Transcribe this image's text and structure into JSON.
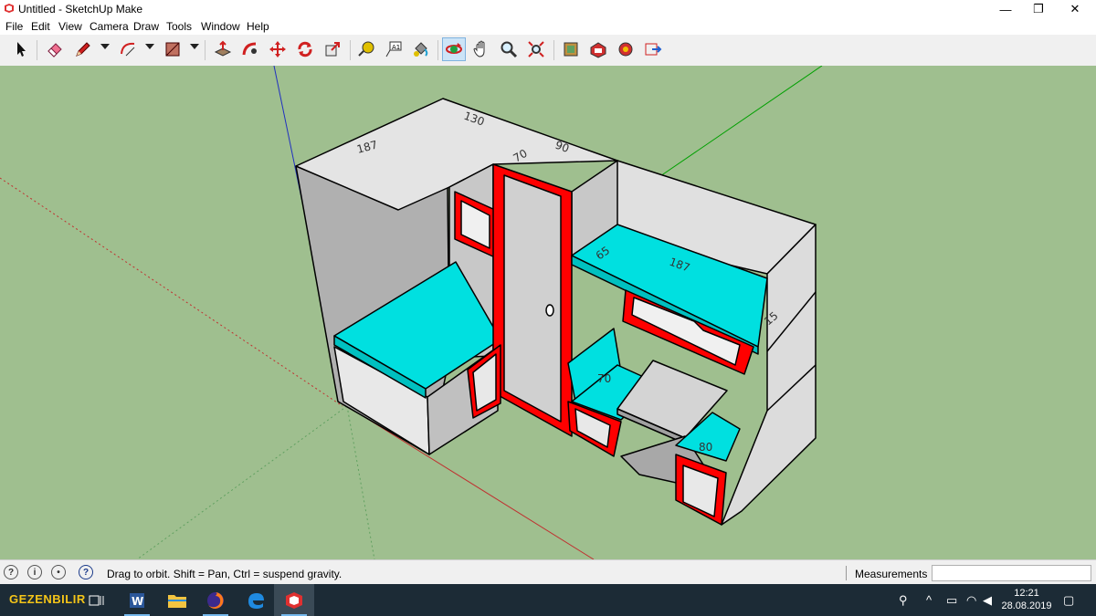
{
  "window": {
    "title": "Untitled - SketchUp Make",
    "minimize": "—",
    "maximize": "❐",
    "close": "✕"
  },
  "menu": [
    "File",
    "Edit",
    "View",
    "Camera",
    "Draw",
    "Tools",
    "Window",
    "Help"
  ],
  "toolbar": {
    "tools": [
      "select",
      "eraser",
      "pencil",
      "arc",
      "rectangle",
      "push-pull",
      "follow-me",
      "move",
      "rotate",
      "scale",
      "tape-measure",
      "text",
      "paint-bucket",
      "orbit",
      "pan",
      "zoom",
      "zoom-extents",
      "warehouse",
      "extension-warehouse",
      "layout",
      "share"
    ],
    "active_tool": "orbit"
  },
  "model": {
    "dimensions": [
      "187",
      "130",
      "70",
      "90",
      "65",
      "187",
      "15",
      "70",
      "80"
    ],
    "colors": {
      "shell": "#dcdcdc",
      "edge": "#000000",
      "cushion": "#00e0e0",
      "frame": "#ff0000",
      "ground": "#9fbf8f"
    }
  },
  "status": {
    "hint": "Drag to orbit. Shift = Pan, Ctrl = suspend gravity.",
    "measurements_label": "Measurements",
    "measurements_value": ""
  },
  "taskbar": {
    "brand": "GEZENBILIR",
    "apps": [
      "task-view",
      "word",
      "file-explorer",
      "firefox",
      "edge",
      "sketchup"
    ],
    "time": "12:21",
    "date": "28.08.2019"
  }
}
